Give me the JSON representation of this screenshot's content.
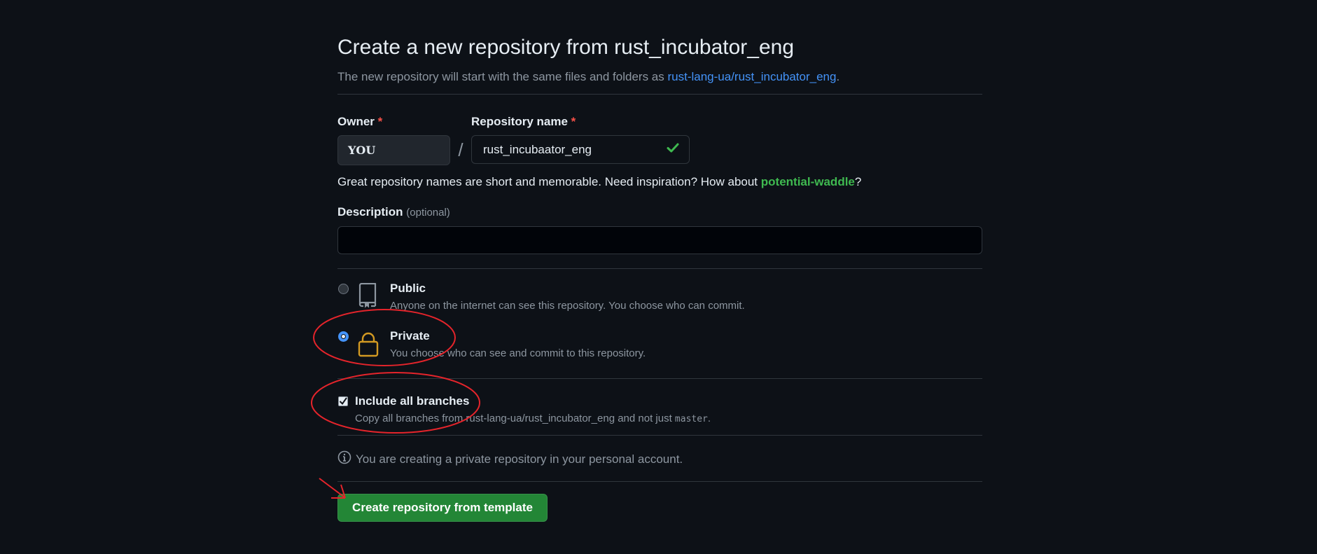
{
  "page": {
    "title": "Create a new repository from rust_incubator_eng",
    "subtitle_prefix": "The new repository will start with the same files and folders as ",
    "subtitle_link": "rust-lang-ua/rust_incubator_eng",
    "subtitle_suffix": "."
  },
  "owner": {
    "label": "Owner",
    "required_mark": "*",
    "value": "YOU"
  },
  "slash": "/",
  "repo_name": {
    "label": "Repository name",
    "required_mark": "*",
    "value": "rust_incubaator_eng"
  },
  "hint": {
    "prefix": "Great repository names are short and memorable. Need inspiration? How about ",
    "suggestion": "potential-waddle",
    "suffix": "?"
  },
  "description": {
    "label": "Description",
    "optional": "(optional)",
    "value": ""
  },
  "visibility": {
    "selected": "private",
    "public": {
      "title": "Public",
      "desc": "Anyone on the internet can see this repository. You choose who can commit."
    },
    "private": {
      "title": "Private",
      "desc": "You choose who can see and commit to this repository."
    }
  },
  "branches": {
    "checked": true,
    "title": "Include all branches",
    "desc_prefix": "Copy all branches from rust-lang-ua/rust_incubator_eng and not just ",
    "desc_code": "master",
    "desc_suffix": "."
  },
  "info": {
    "text": "You are creating a private repository in your personal account."
  },
  "submit": {
    "label": "Create repository from template"
  },
  "colors": {
    "background": "#0d1117",
    "link": "#4493f8",
    "success": "#3fb950",
    "button": "#238636",
    "annotation": "#e5242b",
    "lock_icon": "#d29922"
  }
}
